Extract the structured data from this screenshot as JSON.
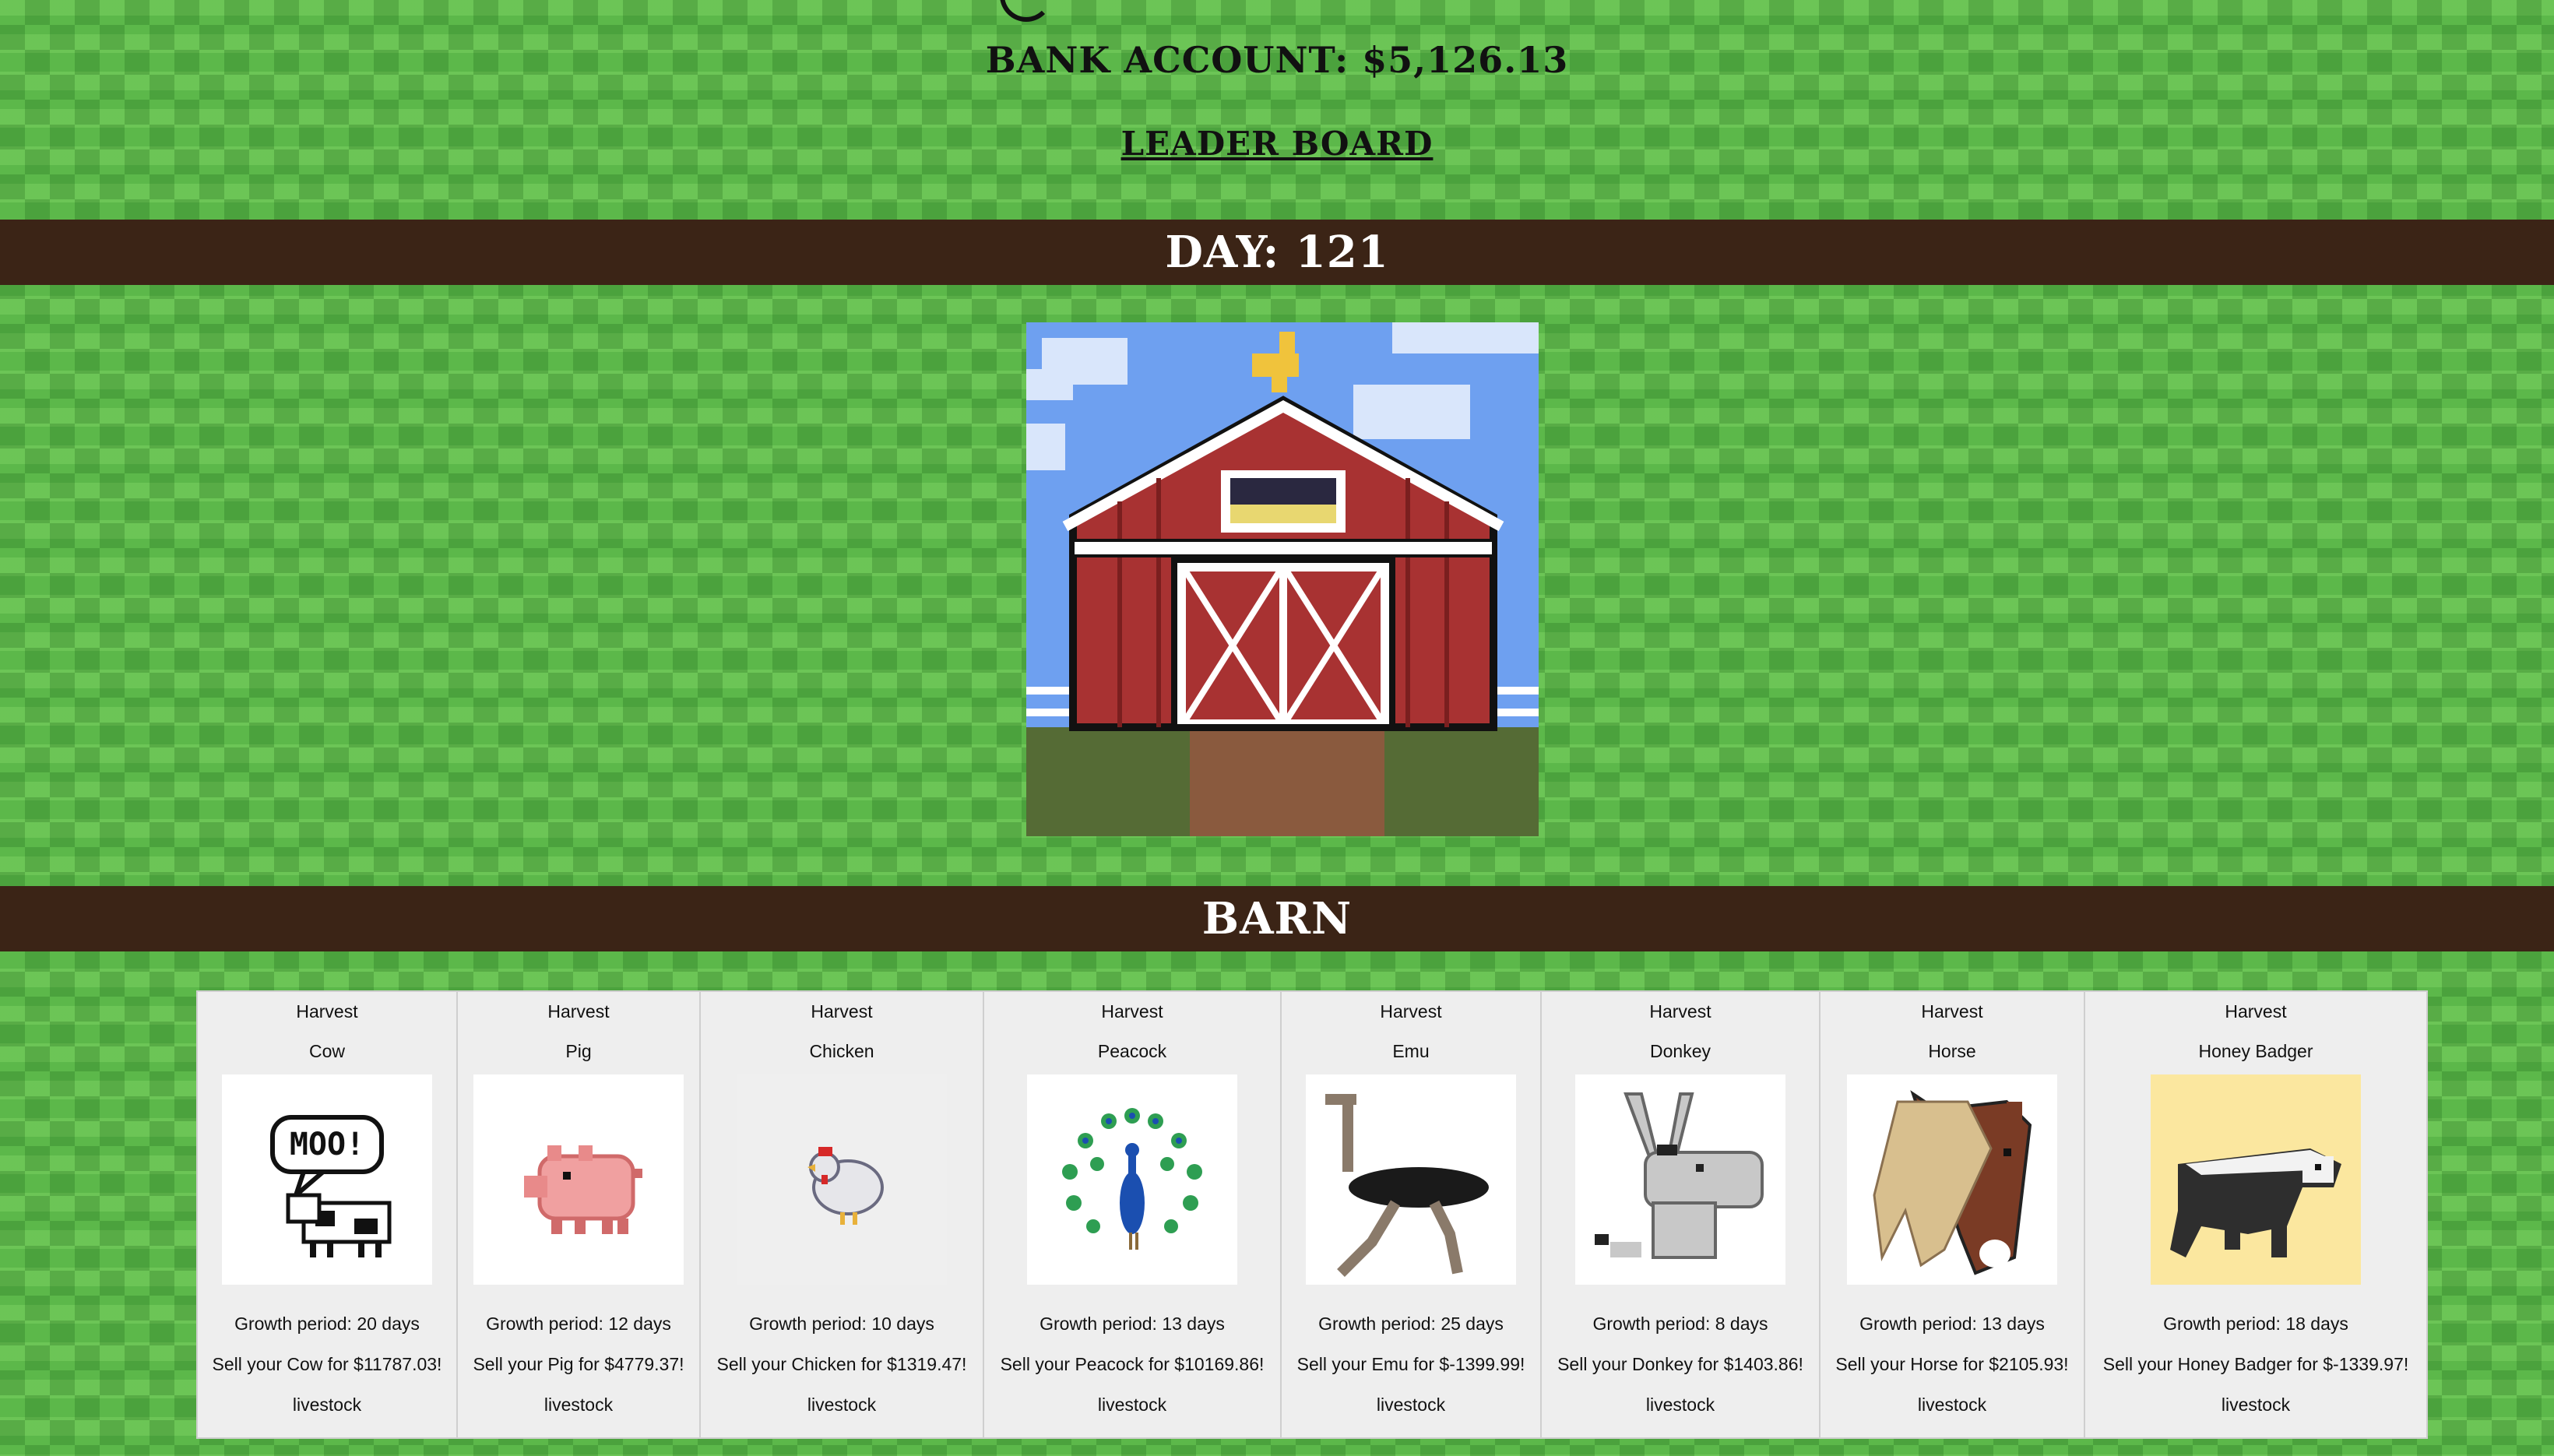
{
  "header": {
    "bank_label": "BANK ACCOUNT:",
    "bank_value": "$5,126.13",
    "leaderboard_label": "LEADER BOARD"
  },
  "day_bar": {
    "label": "DAY:",
    "value": "121"
  },
  "barn_bar": {
    "label": "BARN"
  },
  "animals": [
    {
      "action": "Harvest",
      "name": "Cow",
      "growth": "Growth period: 20 days",
      "sell": "Sell your Cow for $11787.03!",
      "type": "livestock",
      "icon": "cow-moo-icon"
    },
    {
      "action": "Harvest",
      "name": "Pig",
      "growth": "Growth period: 12 days",
      "sell": "Sell your Pig for $4779.37!",
      "type": "livestock",
      "icon": "pig-icon"
    },
    {
      "action": "Harvest",
      "name": "Chicken",
      "growth": "Growth period: 10 days",
      "sell": "Sell your Chicken for $1319.47!",
      "type": "livestock",
      "icon": "chicken-icon"
    },
    {
      "action": "Harvest",
      "name": "Peacock",
      "growth": "Growth period: 13 days",
      "sell": "Sell your Peacock for $10169.86!",
      "type": "livestock",
      "icon": "peacock-icon"
    },
    {
      "action": "Harvest",
      "name": "Emu",
      "growth": "Growth period: 25 days",
      "sell": "Sell your Emu for $-1399.99!",
      "type": "livestock",
      "icon": "emu-icon"
    },
    {
      "action": "Harvest",
      "name": "Donkey",
      "growth": "Growth period: 8 days",
      "sell": "Sell your Donkey for $1403.86!",
      "type": "livestock",
      "icon": "donkey-icon"
    },
    {
      "action": "Harvest",
      "name": "Horse",
      "growth": "Growth period: 13 days",
      "sell": "Sell your Horse for $2105.93!",
      "type": "livestock",
      "icon": "horse-icon"
    },
    {
      "action": "Harvest",
      "name": "Honey Badger",
      "growth": "Growth period: 18 days",
      "sell": "Sell your Honey Badger for $-1339.97!",
      "type": "livestock",
      "icon": "honey-badger-icon"
    }
  ],
  "colors": {
    "grass": "#5cb84a",
    "band": "#3b2416",
    "barn_red": "#a83232",
    "sky": "#6ea0f0"
  }
}
